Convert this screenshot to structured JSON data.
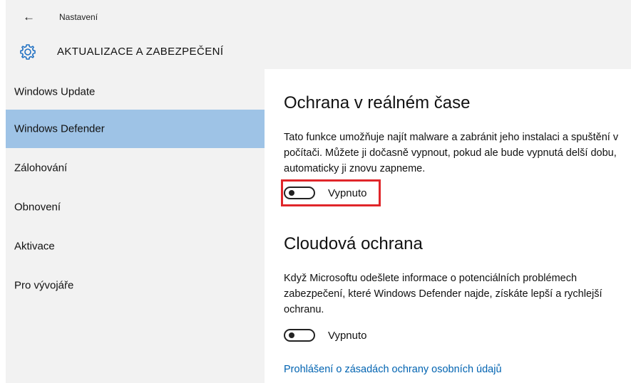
{
  "header": {
    "back_icon": "arrow-left-icon",
    "breadcrumb": "Nastavení",
    "section_icon": "gear-icon",
    "section_title": "AKTUALIZACE A ZABEZPEČENÍ"
  },
  "sidebar": {
    "selected_color": "#9ec3e6",
    "items": [
      {
        "label": "Windows Update"
      },
      {
        "label": "Windows Defender"
      },
      {
        "label": "Zálohování"
      },
      {
        "label": "Obnovení"
      },
      {
        "label": "Aktivace"
      },
      {
        "label": "Pro vývojáře"
      }
    ],
    "selected_index": 1
  },
  "main": {
    "realtime": {
      "title": "Ochrana v reálném čase",
      "description": "Tato funkce umožňuje najít malware a zabránit jeho instalaci a spuštění v počítači. Můžete ji dočasně vypnout, pokud ale bude vypnutá delší dobu, automaticky ji znovu zapneme.",
      "toggle_label": "Vypnuto",
      "toggle_on": false,
      "highlight_color": "#e0262a"
    },
    "cloud": {
      "title": "Cloudová ochrana",
      "description": "Když Microsoftu odešlete informace o potenciálních problémech zabezpečení, které Windows Defender najde, získáte lepší a rychlejší ochranu.",
      "toggle_label": "Vypnuto",
      "toggle_on": false
    },
    "privacy_link": "Prohlášení o zásadách ochrany osobních údajů",
    "link_color": "#0063b1"
  }
}
